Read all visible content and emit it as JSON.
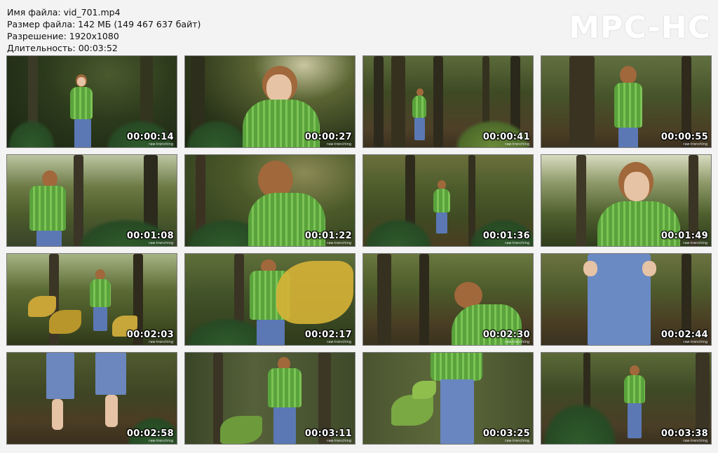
{
  "info": {
    "filename": "Имя файла: vid_701.mp4",
    "filesize": "Размер файла: 142 МБ (149 467 637 байт)",
    "resolution": "Разрешение: 1920x1080",
    "duration": "Длительность: 00:03:52"
  },
  "logo": "MPC-HC",
  "watermark": "raw-trenching",
  "thumbnails": [
    {
      "time": "00:00:14",
      "scene": "Woman in green plaid jacket standing among mossy trees and ferns"
    },
    {
      "time": "00:00:27",
      "scene": "Close-up of woman with glasses in mossy forest"
    },
    {
      "time": "00:00:41",
      "scene": "Woman standing far away on forest path"
    },
    {
      "time": "00:00:55",
      "scene": "Woman standing near large tree trunk"
    },
    {
      "time": "00:01:08",
      "scene": "Woman walking in sunny forest clearing"
    },
    {
      "time": "00:01:22",
      "scene": "Woman seen from behind touching her hair"
    },
    {
      "time": "00:01:36",
      "scene": "Woman standing in forest undergrowth"
    },
    {
      "time": "00:01:49",
      "scene": "Woman with glasses, low angle, backlit forest"
    },
    {
      "time": "00:02:03",
      "scene": "Woman behind yellow autumn leaves"
    },
    {
      "time": "00:02:17",
      "scene": "Woman from behind with blurred yellow leaf in foreground"
    },
    {
      "time": "00:02:30",
      "scene": "Woman bending down in forest"
    },
    {
      "time": "00:02:44",
      "scene": "Woman in jeans, hands on hips"
    },
    {
      "time": "00:02:58",
      "scene": "Close-up of legs in jeans and sandals"
    },
    {
      "time": "00:03:11",
      "scene": "Woman in blurred forest background with leaves in foreground"
    },
    {
      "time": "00:03:25",
      "scene": "Woman behind leaves, torso and jeans"
    },
    {
      "time": "00:03:38",
      "scene": "Woman standing on forest path among ferns"
    }
  ]
}
